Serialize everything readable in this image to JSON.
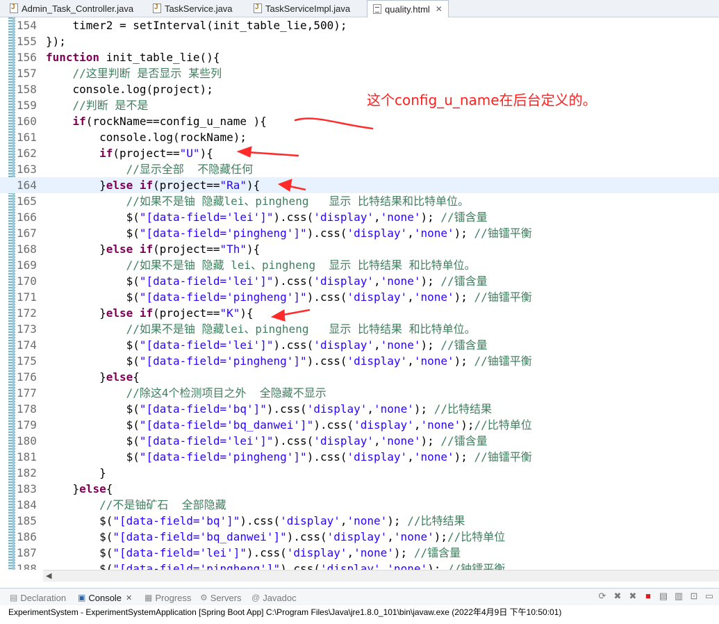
{
  "tabs": [
    {
      "label": "Admin_Task_Controller.java",
      "icon": "java-file-icon",
      "active": false
    },
    {
      "label": "TaskService.java",
      "icon": "java-file-icon",
      "active": false
    },
    {
      "label": "TaskServiceImpl.java",
      "icon": "java-file-icon",
      "active": false
    },
    {
      "label": "quality.html",
      "icon": "html-file-icon",
      "active": true,
      "close": "✕"
    }
  ],
  "editor": {
    "highlighted_line": 164,
    "lines": [
      {
        "n": "154",
        "code": "    timer2 = setInterval(init_table_lie,500);"
      },
      {
        "n": "155",
        "code": "});"
      },
      {
        "n": "156",
        "code": "function init_table_lie(){"
      },
      {
        "n": "157",
        "code": "    //这里判断 是否显示 某些列"
      },
      {
        "n": "158",
        "code": "    console.log(project);"
      },
      {
        "n": "159",
        "code": "    //判断 是不是"
      },
      {
        "n": "160",
        "code": "    if(rockName==config_u_name ){"
      },
      {
        "n": "161",
        "code": "        console.log(rockName);"
      },
      {
        "n": "162",
        "code": "        if(project==\"U\"){"
      },
      {
        "n": "163",
        "code": "            //显示全部  不隐藏任何"
      },
      {
        "n": "164",
        "code": "        }else if(project==\"Ra\"){"
      },
      {
        "n": "165",
        "code": "            //如果不是铀 隐藏lei、pingheng   显示 比特结果和比特单位。"
      },
      {
        "n": "166",
        "code": "            $(\"[data-field='lei']\").css('display','none'); //镭含量"
      },
      {
        "n": "167",
        "code": "            $(\"[data-field='pingheng']\").css('display','none'); //铀镭平衡"
      },
      {
        "n": "168",
        "code": "        }else if(project==\"Th\"){"
      },
      {
        "n": "169",
        "code": "            //如果不是铀 隐藏 lei、pingheng  显示 比特结果 和比特单位。"
      },
      {
        "n": "170",
        "code": "            $(\"[data-field='lei']\").css('display','none'); //镭含量"
      },
      {
        "n": "171",
        "code": "            $(\"[data-field='pingheng']\").css('display','none'); //铀镭平衡"
      },
      {
        "n": "172",
        "code": "        }else if(project==\"K\"){"
      },
      {
        "n": "173",
        "code": "            //如果不是铀 隐藏lei、pingheng   显示 比特结果 和比特单位。"
      },
      {
        "n": "174",
        "code": "            $(\"[data-field='lei']\").css('display','none'); //镭含量"
      },
      {
        "n": "175",
        "code": "            $(\"[data-field='pingheng']\").css('display','none'); //铀镭平衡"
      },
      {
        "n": "176",
        "code": "        }else{"
      },
      {
        "n": "177",
        "code": "            //除这4个检测项目之外  全隐藏不显示"
      },
      {
        "n": "178",
        "code": "            $(\"[data-field='bq']\").css('display','none'); //比特结果"
      },
      {
        "n": "179",
        "code": "            $(\"[data-field='bq_danwei']\").css('display','none');//比特单位"
      },
      {
        "n": "180",
        "code": "            $(\"[data-field='lei']\").css('display','none'); //镭含量"
      },
      {
        "n": "181",
        "code": "            $(\"[data-field='pingheng']\").css('display','none'); //铀镭平衡"
      },
      {
        "n": "182",
        "code": "        }"
      },
      {
        "n": "183",
        "code": "    }else{"
      },
      {
        "n": "184",
        "code": "        //不是铀矿石  全部隐藏"
      },
      {
        "n": "185",
        "code": "        $(\"[data-field='bq']\").css('display','none'); //比特结果"
      },
      {
        "n": "186",
        "code": "        $(\"[data-field='bq_danwei']\").css('display','none');//比特单位"
      },
      {
        "n": "187",
        "code": "        $(\"[data-field='lei']\").css('display','none'); //镭含量"
      },
      {
        "n": "188",
        "code": "        $(\"[data-field='pingheng']\").css('display','none'); //铀镭平衡"
      }
    ]
  },
  "annotation": {
    "note": "这个config_u_name在后台定义的。",
    "color": "#ff1f1f"
  },
  "panel": {
    "tabs": [
      {
        "label": "Declaration",
        "icon": "declaration-icon",
        "glyph": "▤",
        "active": false
      },
      {
        "label": "Console",
        "icon": "console-icon",
        "glyph": "▣",
        "active": true,
        "close": "✕"
      },
      {
        "label": "Progress",
        "icon": "progress-icon",
        "glyph": "▦",
        "active": false
      },
      {
        "label": "Servers",
        "icon": "servers-icon",
        "glyph": "⚙",
        "active": false
      },
      {
        "label": "Javadoc",
        "icon": "javadoc-icon",
        "glyph": "@",
        "active": false
      }
    ],
    "toolbar": [
      {
        "name": "reconnect-icon",
        "glyph": "⟳"
      },
      {
        "name": "terminate-remove-icon",
        "glyph": "✖"
      },
      {
        "name": "remove-all-terminated-icon",
        "glyph": "✖"
      },
      {
        "name": "stop-icon",
        "glyph": "■"
      },
      {
        "name": "clear-console-icon",
        "glyph": "▤"
      },
      {
        "name": "scroll-lock-icon",
        "glyph": "▥"
      },
      {
        "name": "pin-console-icon",
        "glyph": "⊡"
      },
      {
        "name": "display-selected-console-icon",
        "glyph": "▭"
      }
    ],
    "console_line": "ExperimentSystem - ExperimentSystemApplication [Spring Boot App] C:\\Program Files\\Java\\jre1.8.0_101\\bin\\javaw.exe (2022年4月9日 下午10:50:01)"
  }
}
